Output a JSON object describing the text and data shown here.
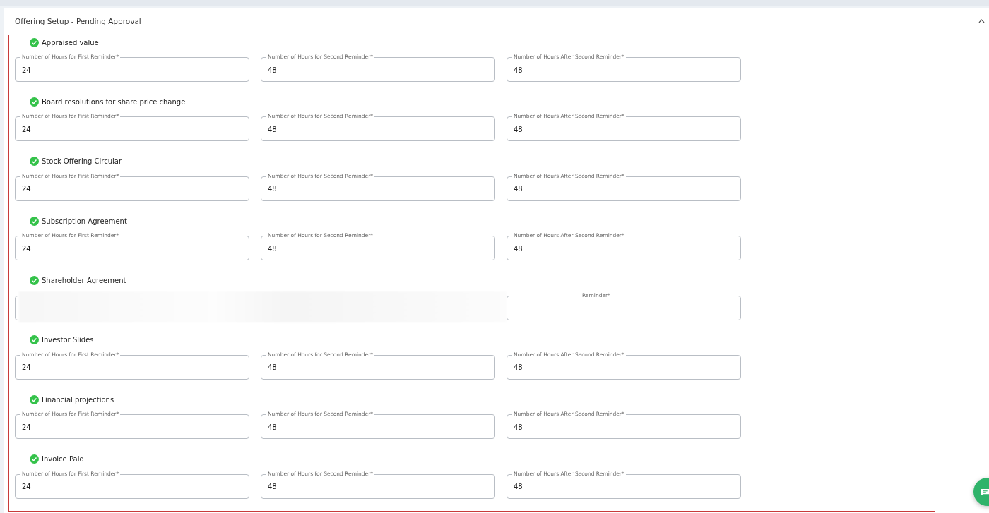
{
  "panel": {
    "title": "Offering Setup - Pending Approval",
    "expanded": true
  },
  "sections": [
    {
      "kind": "fields",
      "title": "Appraised value",
      "done": true,
      "fields": [
        {
          "label": "Number of Hours for First Reminder*",
          "value": "24"
        },
        {
          "label": "Number of Hours for Second Reminder*",
          "value": "48"
        },
        {
          "label": "Number of Hours After Second Reminder*",
          "value": "48"
        }
      ]
    },
    {
      "kind": "fields",
      "title": "Board resolutions for share price change",
      "done": true,
      "fields": [
        {
          "label": "Number of Hours for First Reminder*",
          "value": "24"
        },
        {
          "label": "Number of Hours for Second Reminder*",
          "value": "48"
        },
        {
          "label": "Number of Hours After Second Reminder*",
          "value": "48"
        }
      ]
    },
    {
      "kind": "fields",
      "title": "Stock Offering Circular",
      "done": true,
      "fields": [
        {
          "label": "Number of Hours for First Reminder*",
          "value": "24"
        },
        {
          "label": "Number of Hours for Second Reminder*",
          "value": "48"
        },
        {
          "label": "Number of Hours After Second Reminder*",
          "value": "48"
        }
      ]
    },
    {
      "kind": "fields",
      "title": "Subscription Agreement",
      "done": true,
      "fields": [
        {
          "label": "Number of Hours for First Reminder*",
          "value": "24"
        },
        {
          "label": "Number of Hours for Second Reminder*",
          "value": "48"
        },
        {
          "label": "Number of Hours After Second Reminder*",
          "value": "48"
        }
      ]
    },
    {
      "kind": "redacted",
      "title": "Shareholder Agreement",
      "done": true,
      "partial_label": "Reminder*"
    },
    {
      "kind": "fields",
      "title": "Investor Slides",
      "done": true,
      "fields": [
        {
          "label": "Number of Hours for First Reminder*",
          "value": "24"
        },
        {
          "label": "Number of Hours for Second Reminder*",
          "value": "48"
        },
        {
          "label": "Number of Hours After Second Reminder*",
          "value": "48"
        }
      ]
    },
    {
      "kind": "fields",
      "title": "Financial projections",
      "done": true,
      "fields": [
        {
          "label": "Number of Hours for First Reminder*",
          "value": "24"
        },
        {
          "label": "Number of Hours for Second Reminder*",
          "value": "48"
        },
        {
          "label": "Number of Hours After Second Reminder*",
          "value": "48"
        }
      ]
    },
    {
      "kind": "fields",
      "title": "Invoice Paid",
      "done": true,
      "fields": [
        {
          "label": "Number of Hours for First Reminder*",
          "value": "24"
        },
        {
          "label": "Number of Hours for Second Reminder*",
          "value": "48"
        },
        {
          "label": "Number of Hours After Second Reminder*",
          "value": "48"
        }
      ]
    }
  ]
}
